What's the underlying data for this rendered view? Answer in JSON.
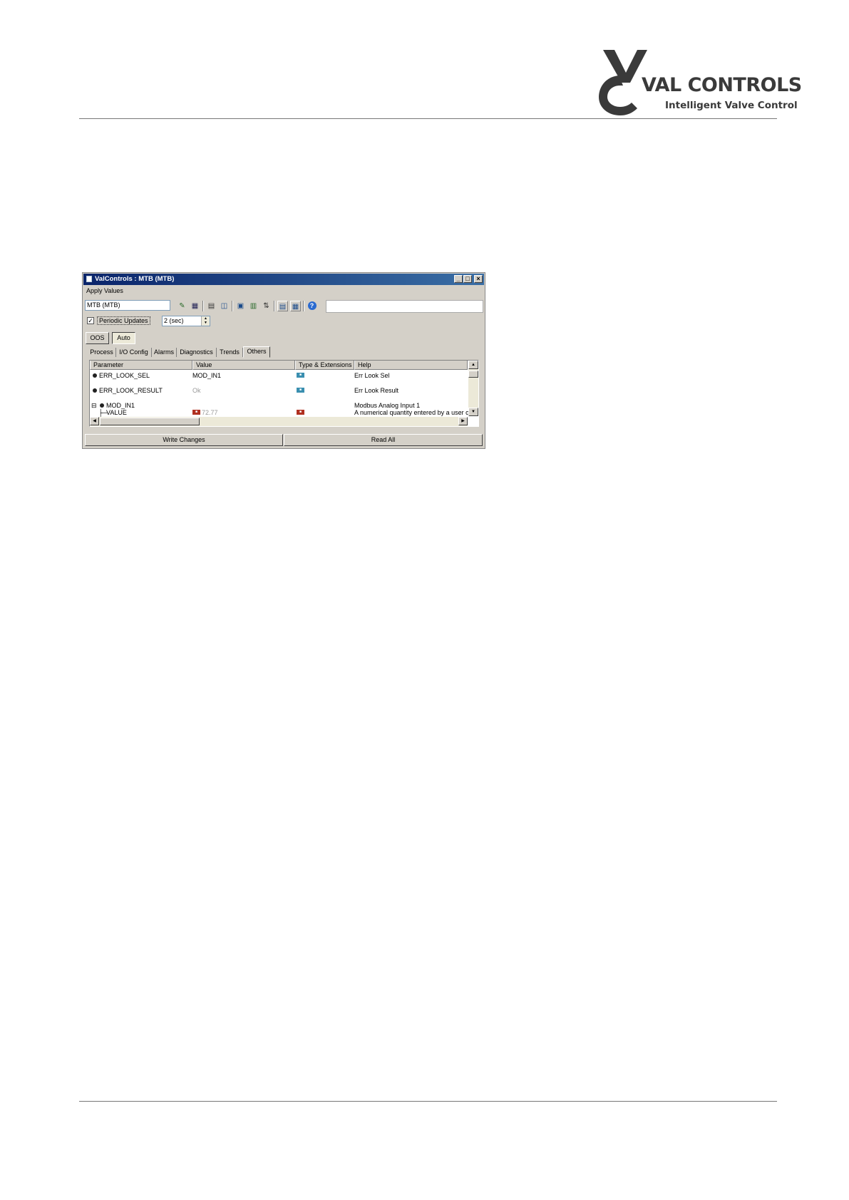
{
  "document": {
    "logo": {
      "brand": "VAL CONTROLS",
      "tagline": "Intelligent Valve Control"
    }
  },
  "window": {
    "title": "ValControls : MTB (MTB)",
    "menu": {
      "apply_values": "Apply Values"
    },
    "toolbar": {
      "device_value": "MTB (MTB)",
      "icons": [
        "edit-icon",
        "grid-icon",
        "calendar-icon",
        "chart-icon",
        "monitor-icon",
        "export-icon",
        "sort-icon",
        "list-view-icon",
        "detail-view-icon",
        "help-icon"
      ]
    },
    "periodic": {
      "label": "Periodic Updates",
      "checked": "✓",
      "interval": "2 (sec)"
    },
    "modes": {
      "oos": "OOS",
      "auto": "Auto"
    },
    "tabs": [
      "Process",
      "I/O Config",
      "Alarms",
      "Diagnostics",
      "Trends",
      "Others"
    ],
    "active_tab": "Others",
    "grid": {
      "columns": [
        "Parameter",
        "Value",
        "Type & Extensions",
        "Help"
      ],
      "rows": [
        {
          "parameter": "ERR_LOOK_SEL",
          "value": "MOD_IN1",
          "help": "Err Look Sel"
        },
        {
          "parameter": "ERR_LOOK_RESULT",
          "value": "Ok",
          "help": "Err Look Result"
        },
        {
          "parameter": "MOD_IN1",
          "value": "",
          "help": "Modbus Analog Input 1"
        },
        {
          "parameter": "VALUE",
          "value": "72.77",
          "help": "A numerical quantity entered by a user or"
        }
      ],
      "tree_toggle": "⊟"
    },
    "buttons": {
      "write_changes": "Write Changes",
      "read_all": "Read All"
    },
    "colors": {
      "titlebar": "#0a246a",
      "badge_cyan": "#3a8fb0",
      "badge_red": "#b03020"
    }
  }
}
